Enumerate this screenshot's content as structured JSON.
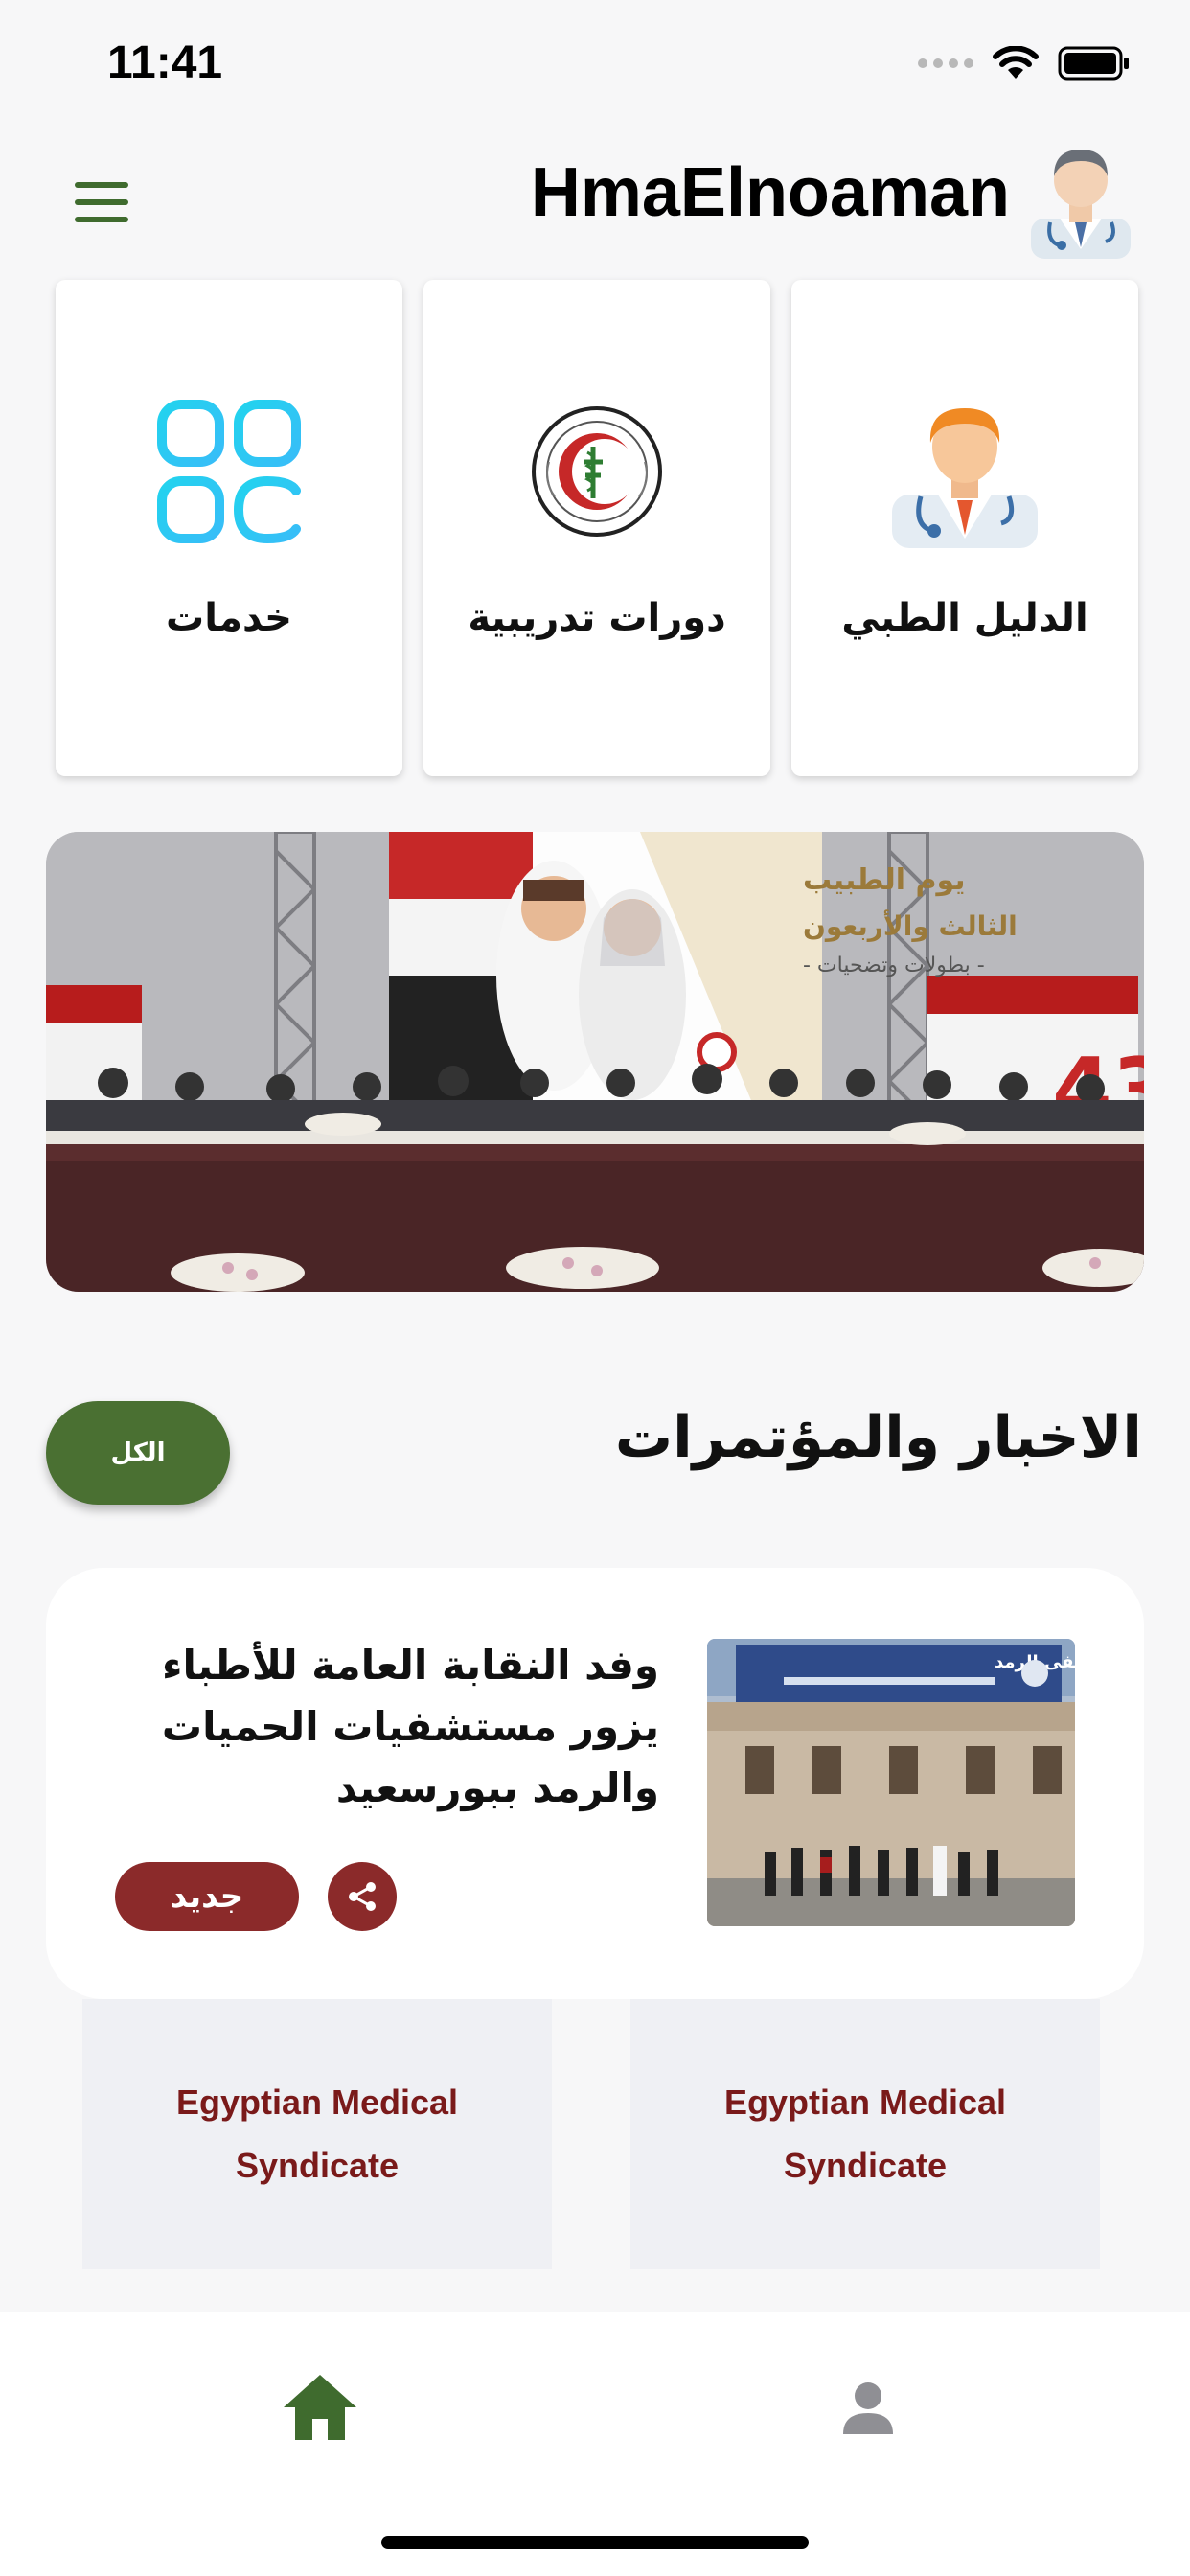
{
  "status_bar": {
    "time": "11:41"
  },
  "header": {
    "title": "HmaElnoaman"
  },
  "cards": [
    {
      "label": "الدليل الطبي",
      "icon": "doctor-icon"
    },
    {
      "label": "دورات تدريبية",
      "icon": "medical-syndicate-logo-icon"
    },
    {
      "label": "خدمات",
      "icon": "services-grid-icon"
    }
  ],
  "banner": {
    "lines": [
      "يوم الطبيب",
      "الثالث والأربعون",
      "- بطولات وتضحيات -"
    ]
  },
  "news_section": {
    "title": "الاخبار والمؤتمرات",
    "all_label": "الكل"
  },
  "news_item": {
    "title": "وفد النقابة العامة للأطباء يزور مستشفيات الحميات والرمد ببورسعيد",
    "badge": "جديد",
    "image_sign": "مستشفى الرمد"
  },
  "syndicate_cards": [
    {
      "label": "Egyptian Medical Syndicate"
    },
    {
      "label": "Egyptian Medical Syndicate"
    }
  ],
  "colors": {
    "accent_green": "#4a7032",
    "badge_red": "#8b2a2a",
    "syndicate_text": "#7a1a1a"
  },
  "bottom_nav": [
    {
      "icon": "home-icon",
      "active": true
    },
    {
      "icon": "profile-icon",
      "active": false
    }
  ]
}
